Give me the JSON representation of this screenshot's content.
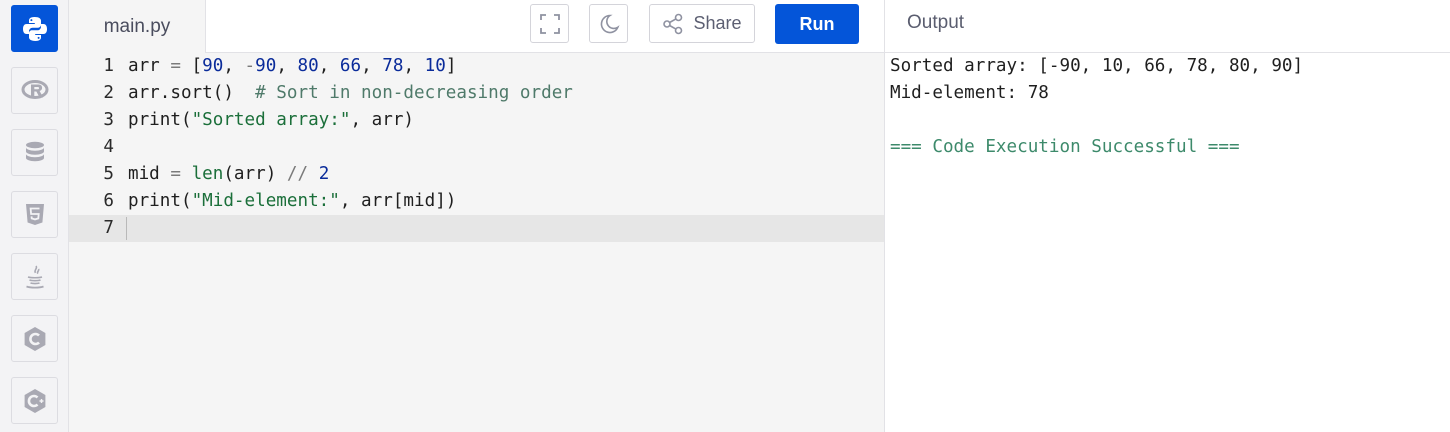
{
  "colors": {
    "accent": "#0455d9",
    "keyword": "#1f1f1f",
    "number": "#0a2b9a",
    "operator": "#7a7a7a",
    "string": "#1b6f3a",
    "comment": "#4f7a6a",
    "success": "#3d8a6b"
  },
  "sidebar": {
    "items": [
      {
        "icon": "python-icon",
        "active": true
      },
      {
        "icon": "r-icon"
      },
      {
        "icon": "database-icon"
      },
      {
        "icon": "html5-icon"
      },
      {
        "icon": "java-icon"
      },
      {
        "icon": "c-icon"
      },
      {
        "icon": "cpp-icon"
      }
    ]
  },
  "editor": {
    "file_tab": "main.py",
    "toolbar": {
      "fullscreen_icon": "fullscreen-icon",
      "theme_icon": "moon-icon",
      "share_label": "Share",
      "run_label": "Run"
    },
    "line_numbers": [
      "1",
      "2",
      "3",
      "4",
      "5",
      "6",
      "7"
    ],
    "lines": [
      [
        {
          "t": "arr "
        },
        {
          "t": "=",
          "c": "operator"
        },
        {
          "t": " ["
        },
        {
          "t": "90",
          "c": "number"
        },
        {
          "t": ", "
        },
        {
          "t": "-",
          "c": "operator"
        },
        {
          "t": "90",
          "c": "number"
        },
        {
          "t": ", "
        },
        {
          "t": "80",
          "c": "number"
        },
        {
          "t": ", "
        },
        {
          "t": "66",
          "c": "number"
        },
        {
          "t": ", "
        },
        {
          "t": "78",
          "c": "number"
        },
        {
          "t": ", "
        },
        {
          "t": "10",
          "c": "number"
        },
        {
          "t": "]"
        }
      ],
      [
        {
          "t": "arr.sort()  "
        },
        {
          "t": "# Sort in non-decreasing order",
          "c": "comment"
        }
      ],
      [
        {
          "t": "print("
        },
        {
          "t": "\"Sorted array:\"",
          "c": "string"
        },
        {
          "t": ", arr)"
        }
      ],
      [],
      [
        {
          "t": "mid "
        },
        {
          "t": "=",
          "c": "operator"
        },
        {
          "t": " "
        },
        {
          "t": "len",
          "c": "string"
        },
        {
          "t": "(arr) "
        },
        {
          "t": "//",
          "c": "operator"
        },
        {
          "t": " "
        },
        {
          "t": "2",
          "c": "number"
        }
      ],
      [
        {
          "t": "print("
        },
        {
          "t": "\"Mid-element:\"",
          "c": "string"
        },
        {
          "t": ", arr[mid])"
        }
      ],
      []
    ]
  },
  "output": {
    "title": "Output",
    "lines": [
      {
        "text": "Sorted array: [-90, 10, 66, 78, 80, 90]"
      },
      {
        "text": "Mid-element: 78"
      },
      {
        "text": ""
      },
      {
        "text": "=== Code Execution Successful ===",
        "c": "success"
      }
    ]
  }
}
